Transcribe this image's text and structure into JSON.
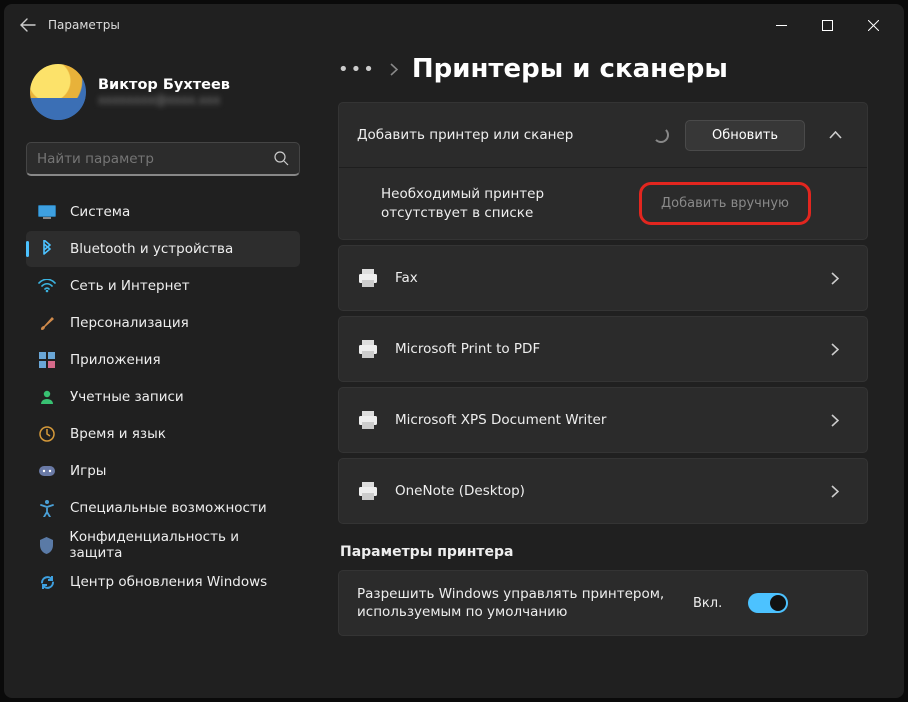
{
  "window": {
    "title": "Параметры"
  },
  "user": {
    "name": "Виктор Бухтеев",
    "email": "xxxxxxxx@xxxx.xxx"
  },
  "search": {
    "placeholder": "Найти параметр"
  },
  "sidebar": {
    "items": [
      {
        "label": "Система"
      },
      {
        "label": "Bluetooth и устройства"
      },
      {
        "label": "Сеть и Интернет"
      },
      {
        "label": "Персонализация"
      },
      {
        "label": "Приложения"
      },
      {
        "label": "Учетные записи"
      },
      {
        "label": "Время и язык"
      },
      {
        "label": "Игры"
      },
      {
        "label": "Специальные возможности"
      },
      {
        "label": "Конфиденциальность и защита"
      },
      {
        "label": "Центр обновления Windows"
      }
    ]
  },
  "page": {
    "title": "Принтеры и сканеры",
    "add_label": "Добавить принтер или сканер",
    "refresh": "Обновить",
    "missing_label": "Необходимый принтер отсутствует в списке",
    "add_manual": "Добавить вручную",
    "printers": [
      {
        "name": "Fax"
      },
      {
        "name": "Microsoft Print to PDF"
      },
      {
        "name": "Microsoft XPS Document Writer"
      },
      {
        "name": "OneNote (Desktop)"
      }
    ],
    "settings_header": "Параметры принтера",
    "default_mgmt": "Разрешить Windows управлять принтером, используемым по умолчанию",
    "toggle_on": "Вкл."
  }
}
